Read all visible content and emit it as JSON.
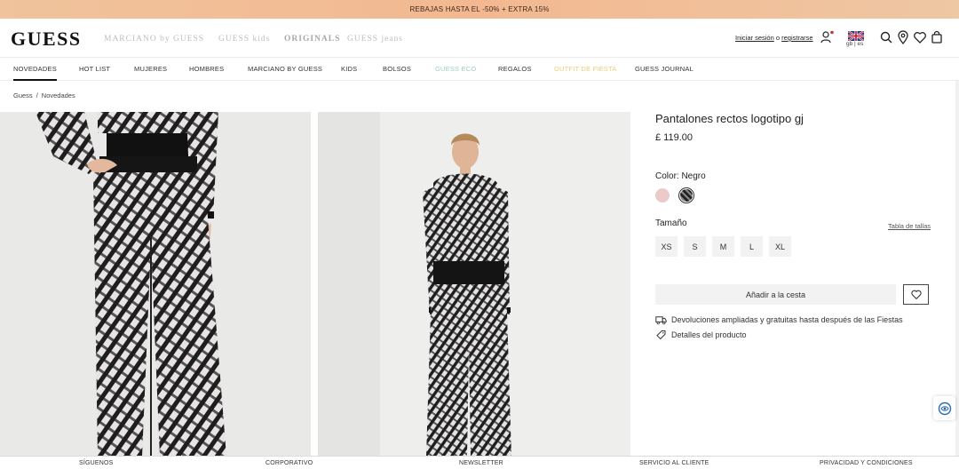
{
  "promo": {
    "text": "REBAJAS HASTA EL -50% + EXTRA 15%"
  },
  "header": {
    "logo": "GUESS",
    "brands": {
      "marciano": "MARCIANO by GUESS",
      "kids": "GUESS kids",
      "originals": "ORIGINALS",
      "jeans": "GUESS jeans"
    },
    "account": {
      "login": "Iniciar sesión",
      "separator": "o",
      "register": "registrarse"
    },
    "lang": "gb | es"
  },
  "nav": {
    "items": [
      "NOVEDADES",
      "HOT LIST",
      "MUJERES",
      "HOMBRES",
      "MARCIANO BY GUESS",
      "KIDS",
      "BOLSOS",
      "GUESS ECO",
      "REGALOS",
      "OUTFIT DE FIESTA",
      "GUESS JOURNAL"
    ],
    "active_index": 0
  },
  "breadcrumb": {
    "home": "Guess",
    "sep": "/",
    "current": "Novedades"
  },
  "product": {
    "title": "Pantalones rectos logotipo gj",
    "price": "£ 119.00",
    "color_label": "Color: Negro",
    "size_label": "Tamaño",
    "size_table": "Tabla de tallas",
    "sizes": [
      "XS",
      "S",
      "M",
      "L",
      "XL"
    ],
    "add_to_cart": "Añadir a la cesta",
    "returns": "Devoluciones ampliadas y gratuitas hasta después de las Fiestas",
    "details": "Detalles del producto"
  },
  "footer": {
    "items": [
      "SÍGUENOS",
      "CORPORATIVO",
      "NEWSLETTER",
      "SERVICIO AL CLIENTE",
      "PRIVACIDAD Y CONDICIONES"
    ]
  },
  "colors": {
    "promo_bg": "#f3b890",
    "eco_nav": "#9fd0c2",
    "fiesta_nav": "#e6cf7a",
    "swatch_pink": "#ebcaca",
    "swatch_black": "#222222"
  }
}
